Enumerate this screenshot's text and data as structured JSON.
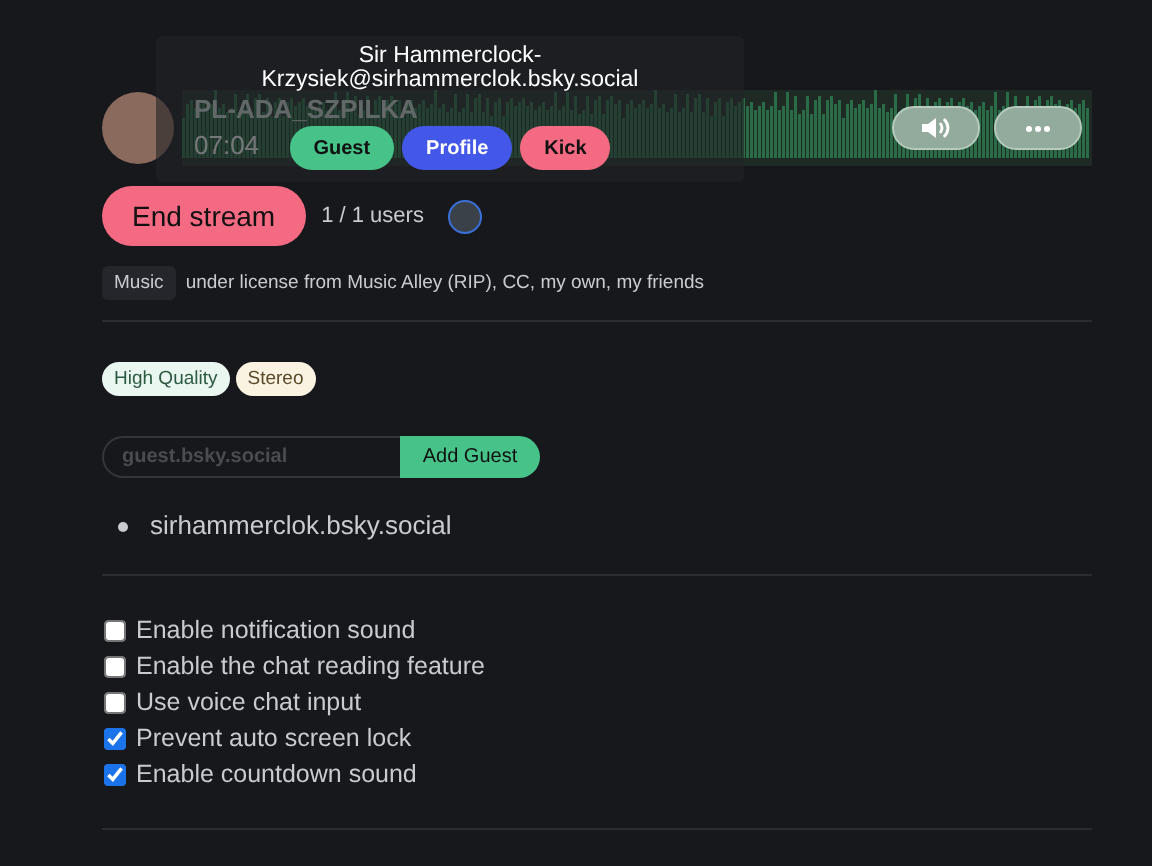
{
  "player": {
    "track_title": "PL-ADA_SZPILKA",
    "track_time": "07:04"
  },
  "tooltip": {
    "user": "Sir Hammerclock-Krzysiek@sirhammerclok.bsky.social",
    "actions": [
      {
        "label": "Guest",
        "kind": "guest"
      },
      {
        "label": "Profile",
        "kind": "profile"
      },
      {
        "label": "Kick",
        "kind": "kick"
      }
    ]
  },
  "stream": {
    "end_button": "End stream",
    "users": "1 / 1 users"
  },
  "license": {
    "tag": "Music",
    "text": "under license from Music Alley (RIP), CC, my own, my friends"
  },
  "badges": [
    {
      "label": "High Quality",
      "kind": "quality"
    },
    {
      "label": "Stereo",
      "kind": "stereo"
    }
  ],
  "guest_form": {
    "placeholder": "guest.bsky.social",
    "button": "Add Guest"
  },
  "guests": [
    "sirhammerclok.bsky.social"
  ],
  "settings": [
    {
      "label": "Enable notification sound",
      "checked": false
    },
    {
      "label": "Enable the chat reading feature",
      "checked": false
    },
    {
      "label": "Use voice chat input",
      "checked": false
    },
    {
      "label": "Prevent auto screen lock",
      "checked": true
    },
    {
      "label": "Enable countdown sound",
      "checked": true
    }
  ]
}
